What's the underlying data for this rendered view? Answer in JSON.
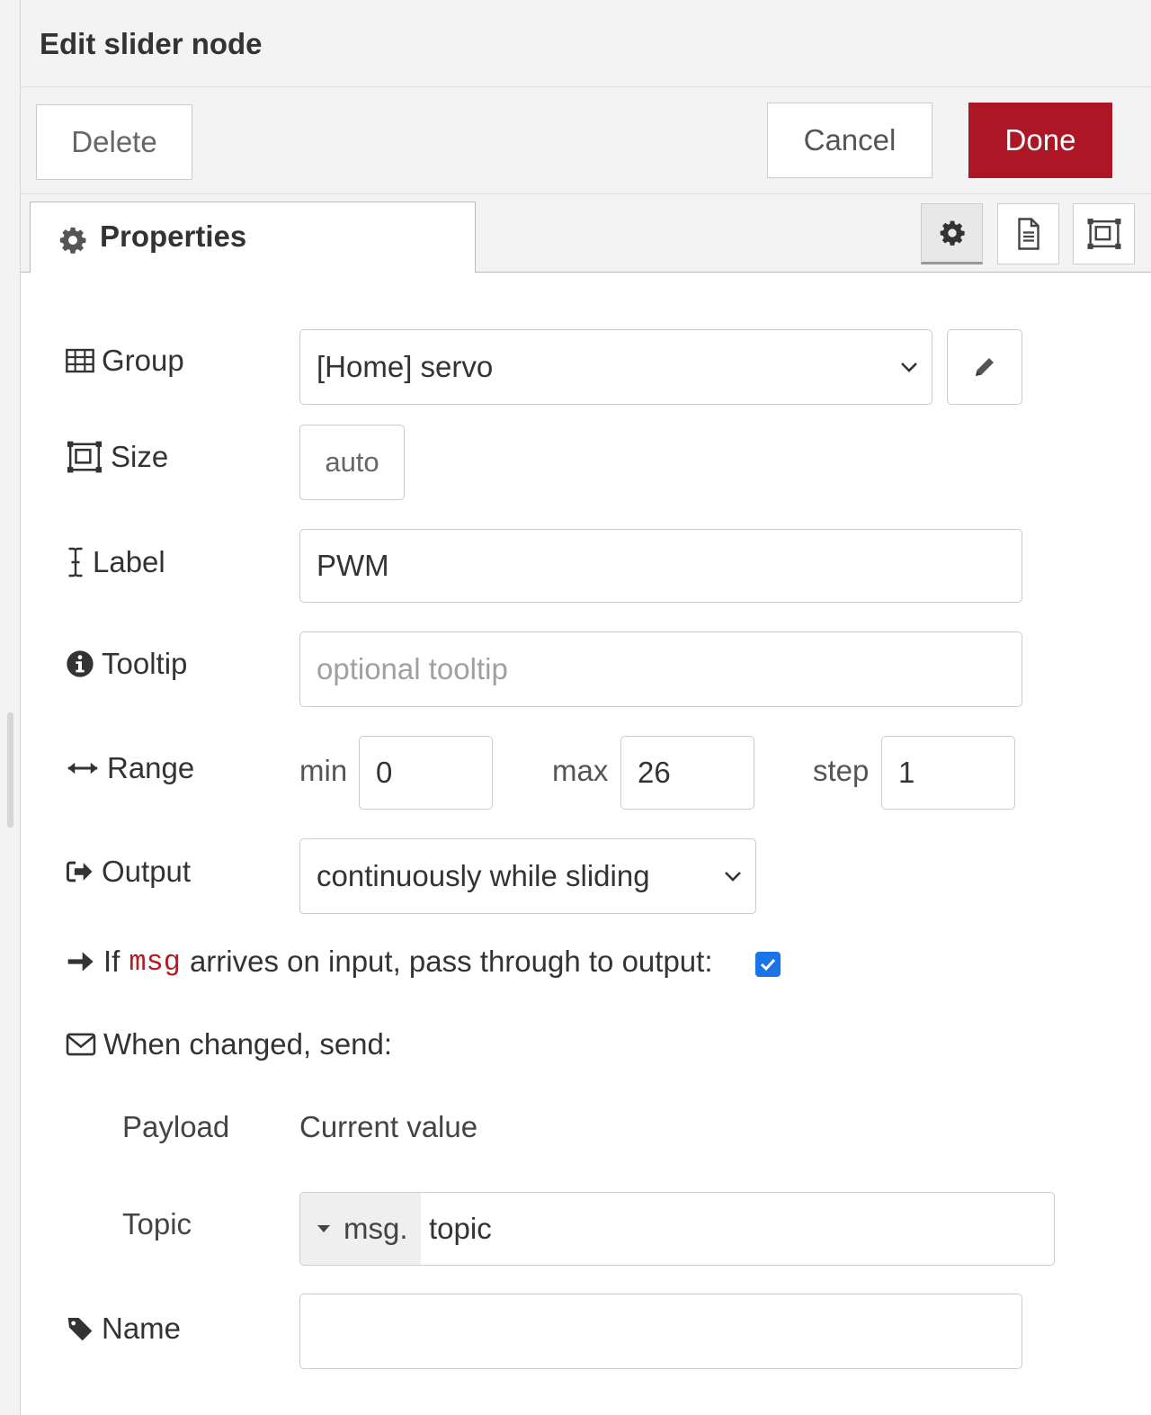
{
  "dialog": {
    "title": "Edit slider node"
  },
  "toolbar": {
    "delete_label": "Delete",
    "cancel_label": "Cancel",
    "done_label": "Done",
    "done_color": "#ad1625"
  },
  "tabs": {
    "properties_label": "Properties",
    "icons": [
      "gear-icon",
      "document-icon",
      "appearance-icon"
    ]
  },
  "form": {
    "group": {
      "label": "Group",
      "value": "[Home] servo",
      "icon": "table-icon"
    },
    "size": {
      "label": "Size",
      "value": "auto",
      "icon": "size-icon"
    },
    "label": {
      "label": "Label",
      "value": "PWM",
      "icon": "text-cursor-icon"
    },
    "tooltip": {
      "label": "Tooltip",
      "placeholder": "optional tooltip",
      "value": "",
      "icon": "info-icon"
    },
    "range": {
      "label": "Range",
      "min_label": "min",
      "min": "0",
      "max_label": "max",
      "max": "26",
      "step_label": "step",
      "step": "1",
      "icon": "arrows-horizontal-icon"
    },
    "output": {
      "label": "Output",
      "value": "continuously while sliding",
      "icon": "sign-out-icon"
    },
    "passthrough": {
      "prefix": "If",
      "code": "msg",
      "suffix": "arrives on input, pass through to output:",
      "checked": true,
      "icon": "arrow-right-icon"
    },
    "when_changed": {
      "label": "When changed, send:",
      "icon": "envelope-icon"
    },
    "payload": {
      "label": "Payload",
      "value": "Current value"
    },
    "topic": {
      "label": "Topic",
      "type_label": "msg.",
      "value": "topic"
    },
    "name": {
      "label": "Name",
      "value": "",
      "icon": "tag-icon"
    }
  }
}
